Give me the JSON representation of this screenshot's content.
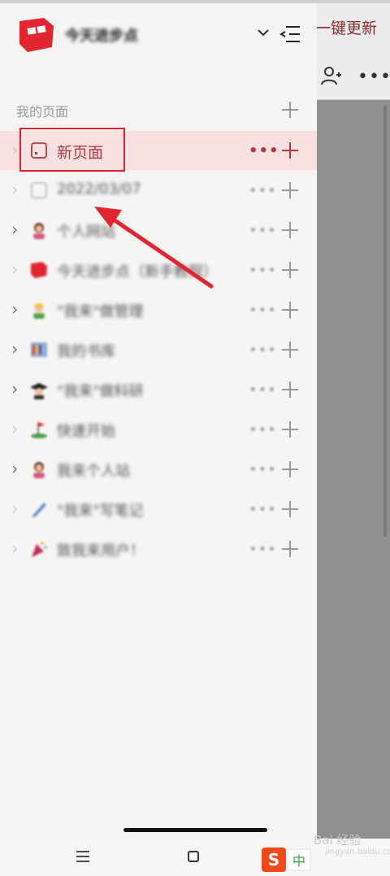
{
  "background": {
    "update_button": "一键更新",
    "add_member_icon": "add-user-icon",
    "more_icon": "more-horizontal-icon"
  },
  "drawer": {
    "workspace_name": "今天进步点",
    "section_title": "我的页面",
    "pages": [
      {
        "label": "新页面",
        "icon": "page-icon",
        "active": true
      },
      {
        "label": "2022/03/07",
        "icon": "page-icon"
      },
      {
        "label": "个人网站",
        "icon": "person-emoji-icon"
      },
      {
        "label": "今天进步点（新手教程）",
        "icon": "logo-icon"
      },
      {
        "label": "\"我来\"做管理",
        "icon": "worker-emoji-icon"
      },
      {
        "label": "我的书库",
        "icon": "library-emoji-icon"
      },
      {
        "label": "\"我来\"做科研",
        "icon": "graduate-emoji-icon"
      },
      {
        "label": "快速开始",
        "icon": "flag-emoji-icon"
      },
      {
        "label": "我来个人站",
        "icon": "person-emoji-icon"
      },
      {
        "label": "\"我来\"写笔记",
        "icon": "pen-emoji-icon"
      },
      {
        "label": "致我来用户！",
        "icon": "party-emoji-icon"
      }
    ]
  },
  "system_nav": {
    "ime_label": "中",
    "ime_logo": "S"
  },
  "watermark": {
    "text": "Bai 经验",
    "sub": "jingyan.baidu.com"
  },
  "colors": {
    "accent": "#d9232a",
    "active_bg": "#f9e1e1",
    "active_text": "#b23a3f"
  }
}
